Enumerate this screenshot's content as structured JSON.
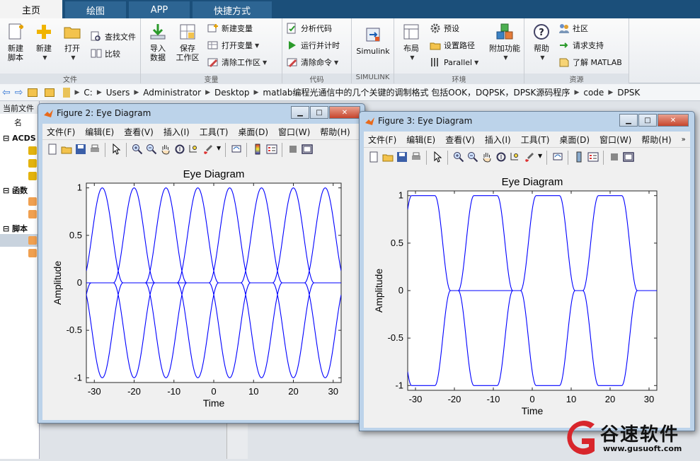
{
  "tabs": [
    "主页",
    "绘图",
    "APP",
    "快捷方式"
  ],
  "ribbon": {
    "file": {
      "label": "文件",
      "new_script": "新建\n脚本",
      "new": "新建",
      "open": "打开",
      "find_files": "查找文件",
      "compare": "比较"
    },
    "variable": {
      "label": "变量",
      "import": "导入\n数据",
      "save_ws": "保存\n工作区",
      "new_var": "新建变量",
      "open_var": "打开变量",
      "clear_ws": "清除工作区"
    },
    "code": {
      "label": "代码",
      "analyze": "分析代码",
      "run_time": "运行并计时",
      "clear_cmd": "清除命令"
    },
    "simulink": {
      "label": "SIMULINK",
      "btn": "Simulink"
    },
    "env": {
      "label": "环境",
      "layout": "布局",
      "prefs": "预设",
      "set_path": "设置路径",
      "parallel": "Parallel",
      "addons": "附加功能"
    },
    "resources": {
      "label": "资源",
      "help": "帮助",
      "community": "社区",
      "support": "请求支持",
      "learn": "了解 MATLAB"
    }
  },
  "address": {
    "crumbs": [
      "C:",
      "Users",
      "Administrator",
      "Desktop",
      "matlab编程光通信中的几个关键的调制格式 包括OOK，DQPSK，DPSK源码程序",
      "code",
      "DPSK"
    ]
  },
  "left_panel": {
    "header": "当前文件",
    "sections": [
      "ACDS",
      "函数",
      "脚本"
    ],
    "col_label": "名"
  },
  "menus": [
    "文件(F)",
    "编辑(E)",
    "查看(V)",
    "插入(I)",
    "工具(T)",
    "桌面(D)",
    "窗口(W)",
    "帮助(H)"
  ],
  "figures": [
    {
      "title": "Figure 2: Eye Diagram",
      "chart_data": {
        "type": "line",
        "title": "Eye Diagram",
        "xlabel": "Time",
        "ylabel": "Amplitude",
        "xlim": [
          -32,
          32
        ],
        "ylim": [
          -1.05,
          1.05
        ],
        "xticks": [
          -30,
          -20,
          -10,
          0,
          10,
          20,
          30
        ],
        "yticks": [
          -1,
          -0.5,
          0,
          0.5,
          1
        ],
        "series": [
          {
            "kind": "pulse",
            "sign": 1,
            "width": 5.2,
            "centers": [
              -28,
              -12,
              4,
              20
            ]
          },
          {
            "kind": "pulse",
            "sign": 1,
            "width": 5.2,
            "centers": [
              -20,
              -4,
              12,
              28
            ]
          },
          {
            "kind": "pulse",
            "sign": -1,
            "width": 5.2,
            "centers": [
              -28,
              -12,
              4,
              20
            ]
          },
          {
            "kind": "pulse",
            "sign": -1,
            "width": 5.2,
            "centers": [
              -36,
              -20,
              -4,
              12,
              28
            ]
          },
          {
            "kind": "segment",
            "x": [
              -20,
              -4
            ],
            "y": [
              0,
              0
            ]
          }
        ]
      }
    },
    {
      "title": "Figure 3: Eye Diagram",
      "chart_data": {
        "type": "line",
        "title": "Eye Diagram",
        "xlabel": "Time",
        "ylabel": "Amplitude",
        "xlim": [
          -32,
          32
        ],
        "ylim": [
          -1.05,
          1.05
        ],
        "xticks": [
          -30,
          -20,
          -10,
          0,
          10,
          20,
          30
        ],
        "yticks": [
          -1,
          -0.5,
          0,
          0.5,
          1
        ],
        "series": [
          {
            "kind": "plateau",
            "sign": 1,
            "plateaus": [
              [
                -31,
                -25
              ],
              [
                -15,
                -9
              ],
              [
                1,
                7
              ],
              [
                17,
                23
              ]
            ]
          },
          {
            "kind": "plateau",
            "sign": -1,
            "plateaus": [
              [
                -31,
                -25
              ],
              [
                -15,
                -9
              ],
              [
                1,
                7
              ],
              [
                17,
                23
              ]
            ]
          },
          {
            "kind": "segment",
            "x": [
              -20,
              -4
            ],
            "y": [
              0,
              0
            ]
          }
        ]
      }
    }
  ],
  "watermark": {
    "brand": "谷速软件",
    "url": "www.gusuoft.com"
  },
  "colors": {
    "line": "#0000ff",
    "window": "#bcd3ea",
    "ribbon_tab": "#1b4f7a"
  }
}
